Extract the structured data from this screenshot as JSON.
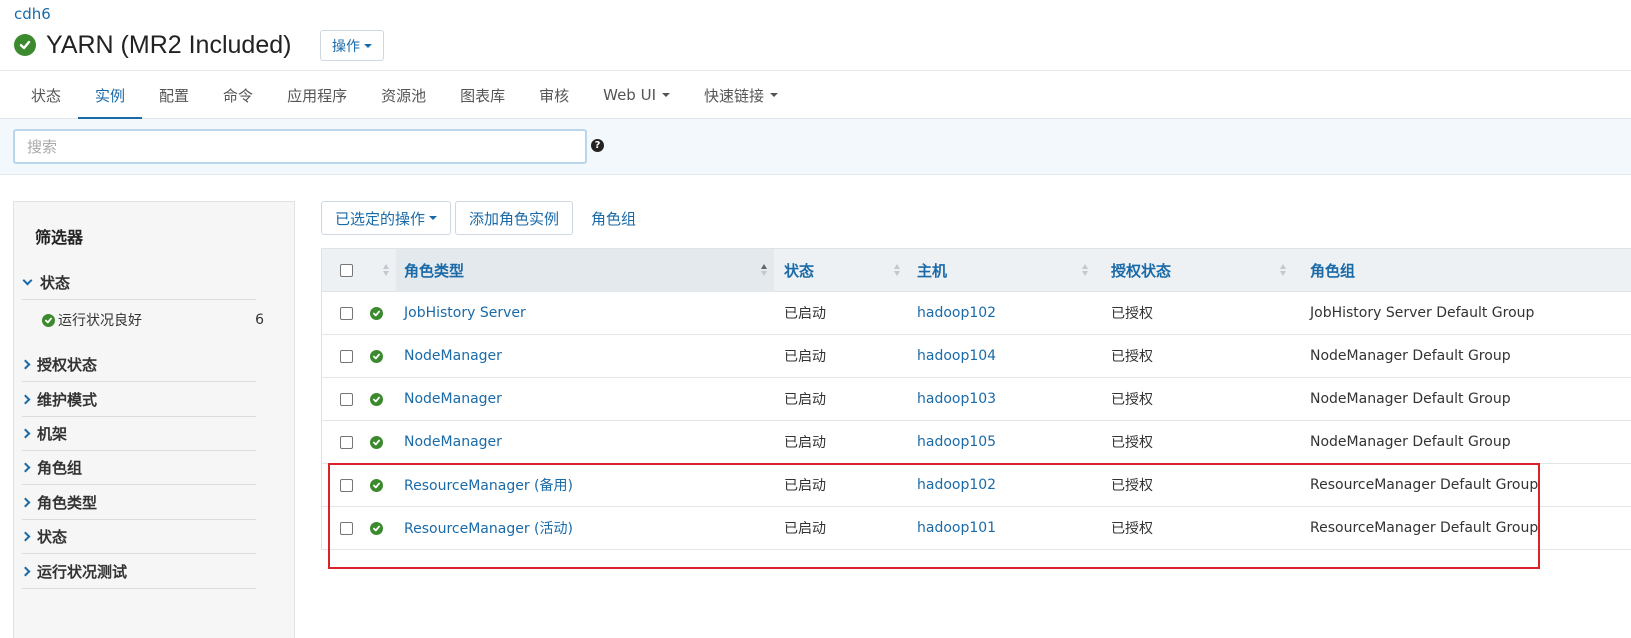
{
  "breadcrumb": "cdh6",
  "service": {
    "title": "YARN (MR2 Included)",
    "status_icon": "healthy-check-icon",
    "actions_label": "操作"
  },
  "tabs": [
    {
      "label": "状态",
      "active": false
    },
    {
      "label": "实例",
      "active": true
    },
    {
      "label": "配置",
      "active": false
    },
    {
      "label": "命令",
      "active": false
    },
    {
      "label": "应用程序",
      "active": false
    },
    {
      "label": "资源池",
      "active": false
    },
    {
      "label": "图表库",
      "active": false
    },
    {
      "label": "审核",
      "active": false
    },
    {
      "label": "Web UI",
      "active": false,
      "dropdown": true
    },
    {
      "label": "快速链接",
      "active": false,
      "dropdown": true
    }
  ],
  "search": {
    "placeholder": "搜索",
    "value": ""
  },
  "filters": {
    "title": "筛选器",
    "sections": [
      {
        "label": "状态",
        "expanded": true
      },
      {
        "label": "授权状态",
        "expanded": false
      },
      {
        "label": "维护模式",
        "expanded": false
      },
      {
        "label": "机架",
        "expanded": false
      },
      {
        "label": "角色组",
        "expanded": false
      },
      {
        "label": "角色类型",
        "expanded": false
      },
      {
        "label": "状态",
        "expanded": false
      },
      {
        "label": "运行状况测试",
        "expanded": false
      }
    ],
    "status_sub": {
      "label": "运行状况良好",
      "count": "6"
    }
  },
  "toolbar": {
    "selected_actions": "已选定的操作",
    "add_role_instance": "添加角色实例",
    "role_groups": "角色组"
  },
  "table": {
    "columns": [
      "角色类型",
      "状态",
      "主机",
      "授权状态",
      "角色组"
    ],
    "sorted_column": "角色类型",
    "rows": [
      {
        "role_type": "JobHistory Server",
        "state": "已启动",
        "host": "hadoop102",
        "auth": "已授权",
        "group": "JobHistory Server Default Group"
      },
      {
        "role_type": "NodeManager",
        "state": "已启动",
        "host": "hadoop104",
        "auth": "已授权",
        "group": "NodeManager Default Group"
      },
      {
        "role_type": "NodeManager",
        "state": "已启动",
        "host": "hadoop103",
        "auth": "已授权",
        "group": "NodeManager Default Group"
      },
      {
        "role_type": "NodeManager",
        "state": "已启动",
        "host": "hadoop105",
        "auth": "已授权",
        "group": "NodeManager Default Group"
      },
      {
        "role_type": "ResourceManager (备用)",
        "state": "已启动",
        "host": "hadoop102",
        "auth": "已授权",
        "group": "ResourceManager Default Group"
      },
      {
        "role_type": "ResourceManager (活动)",
        "state": "已启动",
        "host": "hadoop101",
        "auth": "已授权",
        "group": "ResourceManager Default Group"
      }
    ]
  },
  "colors": {
    "accent": "#1a6aa8",
    "healthy": "#3c8a2e",
    "highlight": "#d9232b"
  }
}
